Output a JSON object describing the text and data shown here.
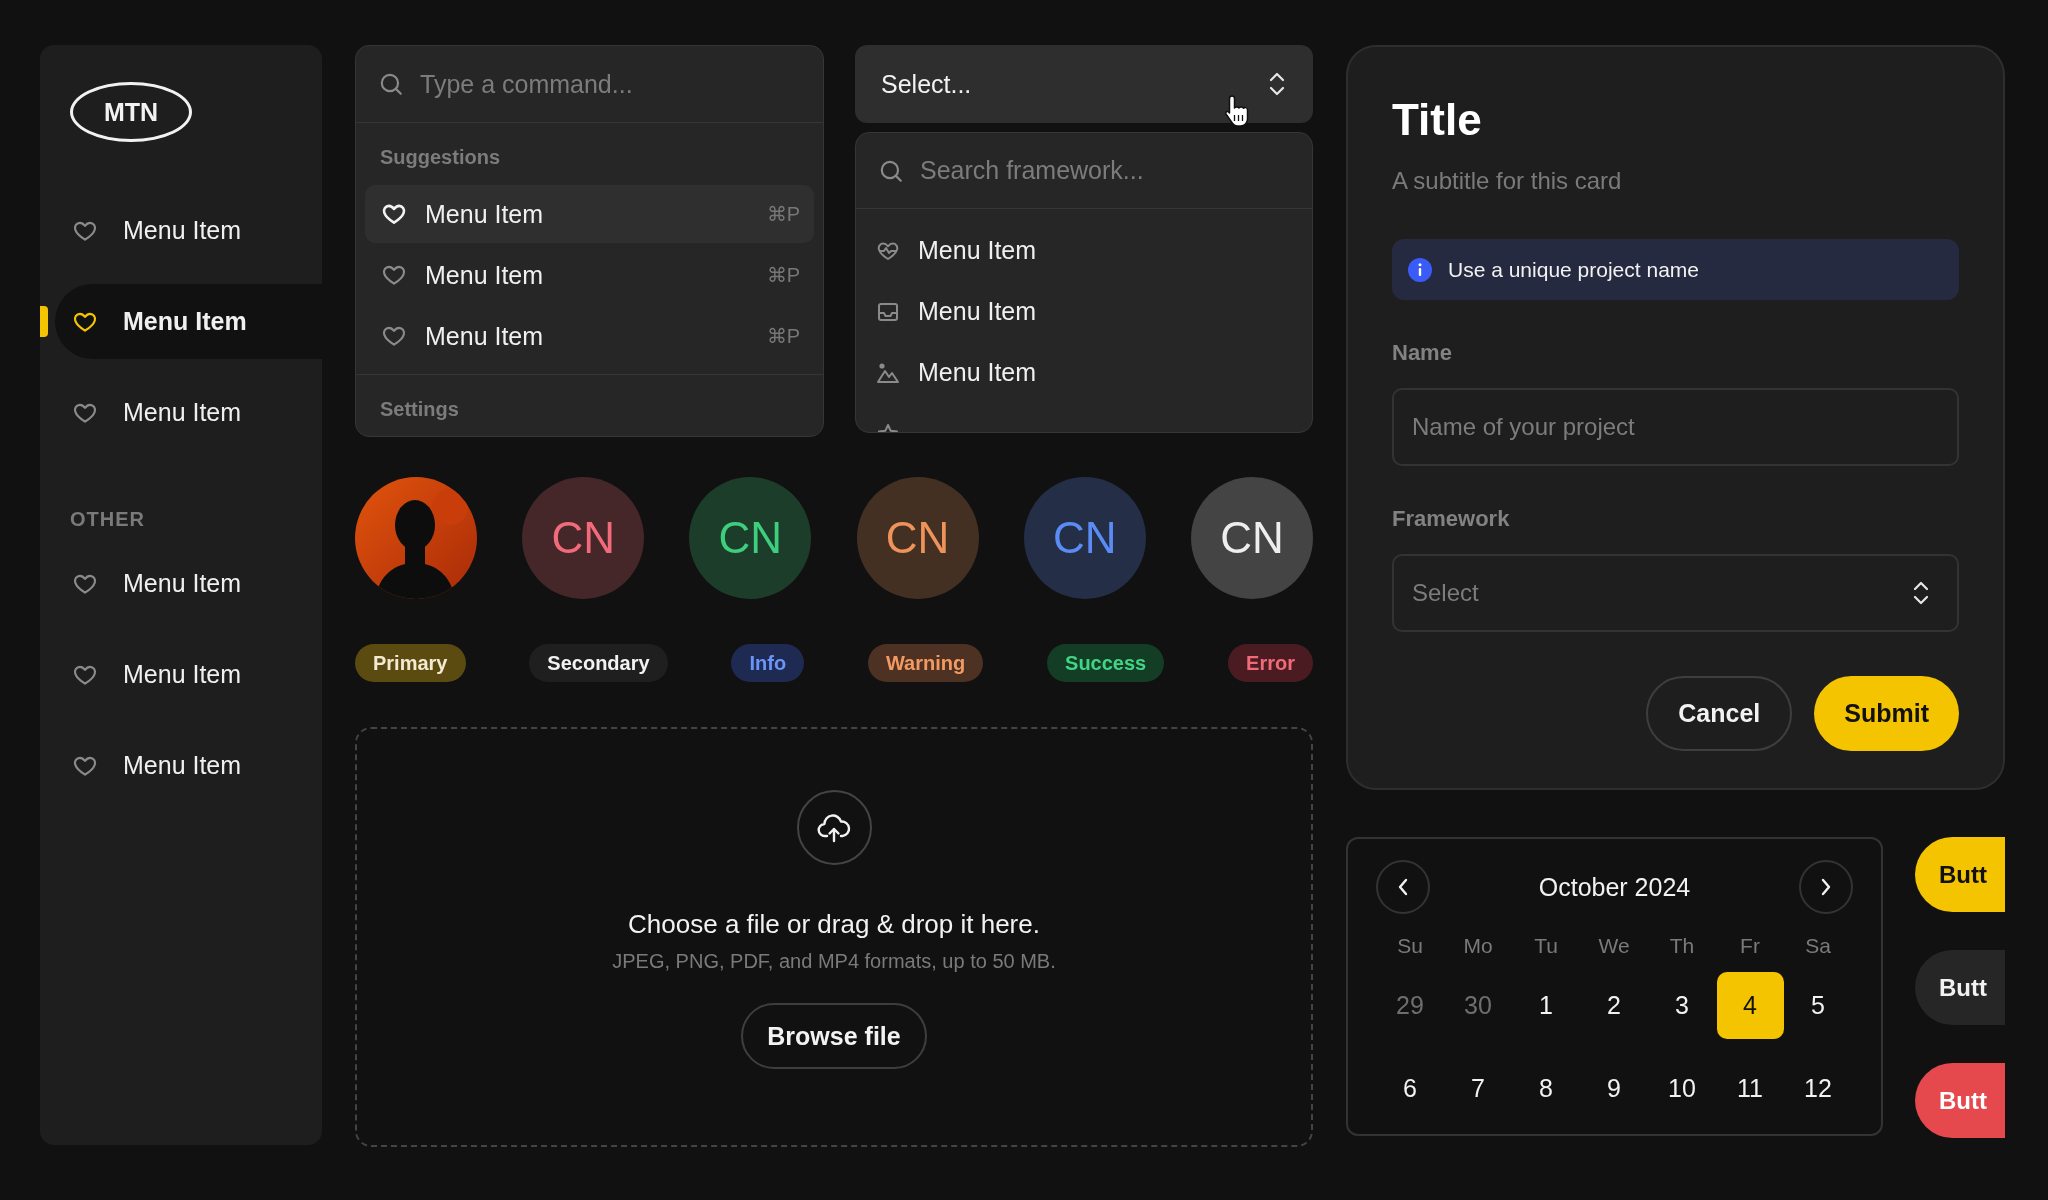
{
  "sidebar": {
    "logo": "MTN",
    "sections": [
      {
        "items": [
          {
            "label": "Menu Item",
            "selected": false
          },
          {
            "label": "Menu Item",
            "selected": true
          },
          {
            "label": "Menu Item",
            "selected": false
          }
        ]
      },
      {
        "heading": "OTHER",
        "items": [
          {
            "label": "Menu Item",
            "selected": false
          },
          {
            "label": "Menu Item",
            "selected": false
          },
          {
            "label": "Menu Item",
            "selected": false
          }
        ]
      }
    ]
  },
  "command": {
    "placeholder": "Type a command...",
    "groups": [
      {
        "heading": "Suggestions",
        "items": [
          {
            "label": "Menu Item",
            "shortcut": "⌘P",
            "selected": true
          },
          {
            "label": "Menu Item",
            "shortcut": "⌘P",
            "selected": false
          },
          {
            "label": "Menu Item",
            "shortcut": "⌘P",
            "selected": false
          }
        ]
      },
      {
        "heading": "Settings"
      }
    ]
  },
  "select": {
    "value": "Select...",
    "search_placeholder": "Search framework...",
    "options": [
      {
        "label": "Menu Item"
      },
      {
        "label": "Menu Item"
      },
      {
        "label": "Menu Item"
      }
    ]
  },
  "avatars": [
    {
      "kind": "picture"
    },
    {
      "kind": "initials",
      "initials": "CN",
      "color": "#f26b7a"
    },
    {
      "kind": "initials",
      "initials": "CN",
      "color": "#3ecf7e"
    },
    {
      "kind": "initials",
      "initials": "CN",
      "color": "#f0935a"
    },
    {
      "kind": "initials",
      "initials": "CN",
      "color": "#5b8cf5"
    },
    {
      "kind": "initials",
      "initials": "CN",
      "color": "#eeeeee"
    }
  ],
  "badges": [
    {
      "label": "Primary",
      "kind": "primary"
    },
    {
      "label": "Secondary",
      "kind": "secondary"
    },
    {
      "label": "Info",
      "kind": "info"
    },
    {
      "label": "Warning",
      "kind": "warning"
    },
    {
      "label": "Success",
      "kind": "success"
    },
    {
      "label": "Error",
      "kind": "error"
    }
  ],
  "upload": {
    "title": "Choose a file or drag & drop it here.",
    "hint": "JPEG, PNG, PDF, and MP4 formats, up to 50 MB.",
    "button": "Browse file"
  },
  "card": {
    "title": "Title",
    "subtitle": "A subtitle for this card",
    "alert": "Use a unique project name",
    "fields": [
      {
        "label": "Name",
        "kind": "input",
        "placeholder": "Name of your project"
      },
      {
        "label": "Framework",
        "kind": "select",
        "placeholder": "Select"
      }
    ],
    "actions": [
      {
        "label": "Cancel",
        "kind": "secondary"
      },
      {
        "label": "Submit",
        "kind": "primary"
      }
    ]
  },
  "calendar": {
    "month": "October 2024",
    "weekdays": [
      "Su",
      "Mo",
      "Tu",
      "We",
      "Th",
      "Fr",
      "Sa"
    ],
    "weeks": [
      [
        {
          "day": "29",
          "outside": true,
          "selected": false
        },
        {
          "day": "30",
          "outside": true,
          "selected": false
        },
        {
          "day": "1",
          "outside": false,
          "selected": false
        },
        {
          "day": "2",
          "outside": false,
          "selected": false
        },
        {
          "day": "3",
          "outside": false,
          "selected": false
        },
        {
          "day": "4",
          "outside": false,
          "selected": true
        },
        {
          "day": "5",
          "outside": false,
          "selected": false
        }
      ],
      [
        {
          "day": "6",
          "outside": false,
          "selected": false
        },
        {
          "day": "7",
          "outside": false,
          "selected": false
        },
        {
          "day": "8",
          "outside": false,
          "selected": false
        },
        {
          "day": "9",
          "outside": false,
          "selected": false
        },
        {
          "day": "10",
          "outside": false,
          "selected": false
        },
        {
          "day": "11",
          "outside": false,
          "selected": false
        },
        {
          "day": "12",
          "outside": false,
          "selected": false
        }
      ]
    ]
  },
  "buttons": [
    {
      "label": "Butt",
      "kind": "primary"
    },
    {
      "label": "Butt",
      "kind": "secondary"
    },
    {
      "label": "Butt",
      "kind": "destructive"
    }
  ]
}
